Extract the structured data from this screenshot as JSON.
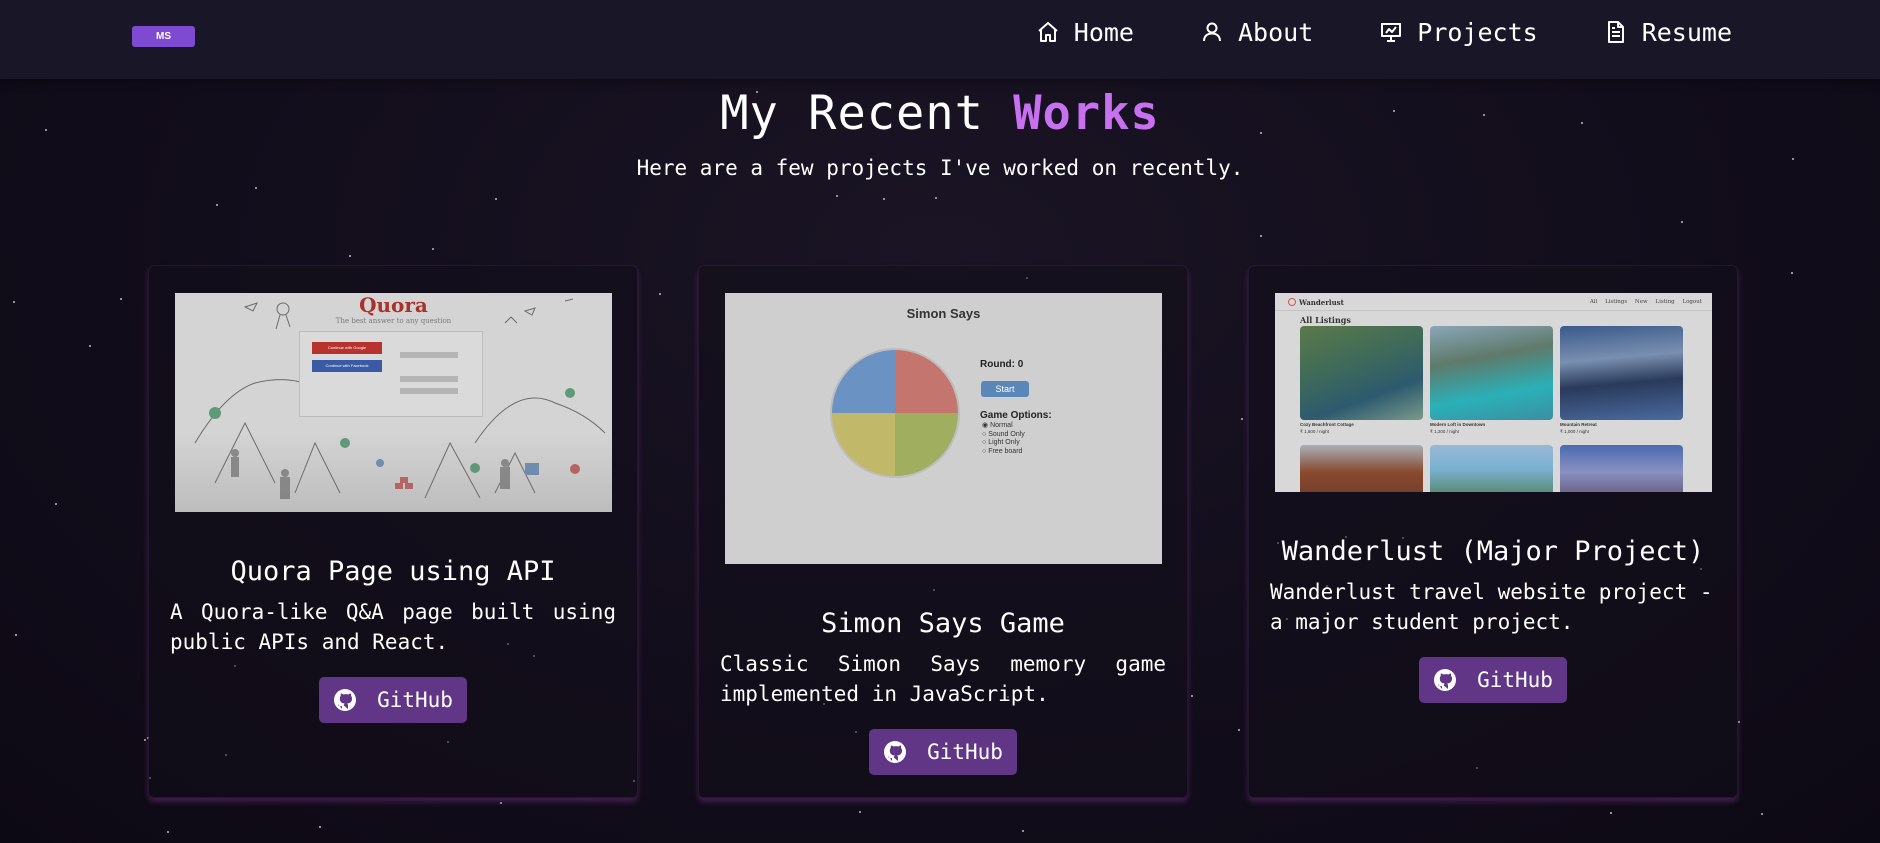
{
  "nav": {
    "logo": "MS",
    "items": [
      {
        "label": "Home",
        "icon": "home-icon"
      },
      {
        "label": "About",
        "icon": "user-icon"
      },
      {
        "label": "Projects",
        "icon": "projects-icon"
      },
      {
        "label": "Resume",
        "icon": "document-icon"
      }
    ]
  },
  "heading": {
    "text": "My Recent",
    "accent": "Works",
    "subtitle": "Here are a few projects I've worked on recently."
  },
  "colors": {
    "accent": "#c770f0",
    "button": "#623686",
    "navbar": "#191627",
    "background": "#120d1b"
  },
  "projects": [
    {
      "title": "Quora Page using API",
      "description": "A Quora-like Q&A page built using public APIs and React.",
      "button": "GitHub",
      "image": {
        "logo": "Quora",
        "tagline": "The best answer to any question",
        "google_button": "Continue with Google",
        "facebook_button": "Continue with Facebook"
      }
    },
    {
      "title": "Simon Says Game",
      "description": "Classic Simon Says memory game implemented in JavaScript.",
      "button": "GitHub",
      "image": {
        "title": "Simon Says",
        "round": "Round: 0",
        "start": "Start",
        "options_label": "Game Options:",
        "options": [
          "Normal",
          "Sound Only",
          "Light Only",
          "Free board"
        ]
      }
    },
    {
      "title": "Wanderlust (Major Project)",
      "description": "Wanderlust travel website project - a major student project.",
      "button": "GitHub",
      "image": {
        "brand": "Wanderlust",
        "links": "All Listings New Listing Logout",
        "heading": "All Listings",
        "listings": [
          {
            "name": "Cozy Beachfront Cottage",
            "price": "₹ 1,500 / night"
          },
          {
            "name": "Modern Loft in Downtown",
            "price": "₹ 1,200 / night"
          },
          {
            "name": "Mountain Retreat",
            "price": "₹ 1,000 / night"
          }
        ]
      }
    }
  ]
}
